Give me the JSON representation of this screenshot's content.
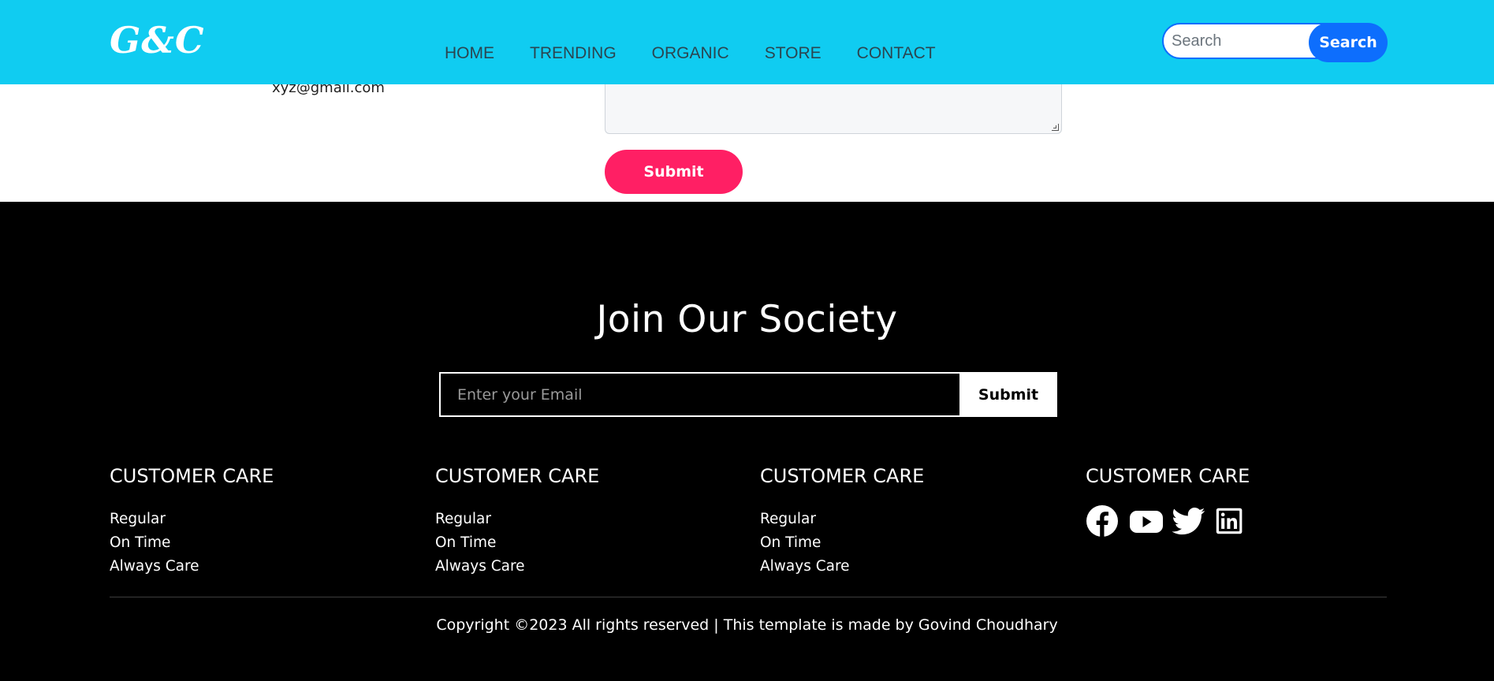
{
  "navbar": {
    "logo": "G&C",
    "links": [
      "HOME",
      "TRENDING",
      "ORGANIC",
      "STORE",
      "CONTACT"
    ],
    "search_placeholder": "Search",
    "search_button": "Search"
  },
  "contact": {
    "email": "xyz@gmail.com",
    "submit_label": "Submit"
  },
  "footer": {
    "title": "Join Our Society",
    "newsletter": {
      "placeholder": "Enter your Email",
      "button": "Submit"
    },
    "columns": [
      {
        "heading": "CUSTOMER CARE",
        "links": [
          "Regular",
          "On Time",
          "Always Care"
        ]
      },
      {
        "heading": "CUSTOMER CARE",
        "links": [
          "Regular",
          "On Time",
          "Always Care"
        ]
      },
      {
        "heading": "CUSTOMER CARE",
        "links": [
          "Regular",
          "On Time",
          "Always Care"
        ]
      },
      {
        "heading": "CUSTOMER CARE",
        "social": [
          "facebook-icon",
          "youtube-icon",
          "twitter-icon",
          "linkedin-icon"
        ]
      }
    ],
    "copyright": "Copyright ©2023 All rights reserved | This template is made by Govind Choudhary"
  },
  "colors": {
    "navbar_bg": "#10ccf1",
    "search_button_bg": "#0d6efd",
    "submit_bg": "#ff1f64",
    "footer_bg": "#000000"
  }
}
